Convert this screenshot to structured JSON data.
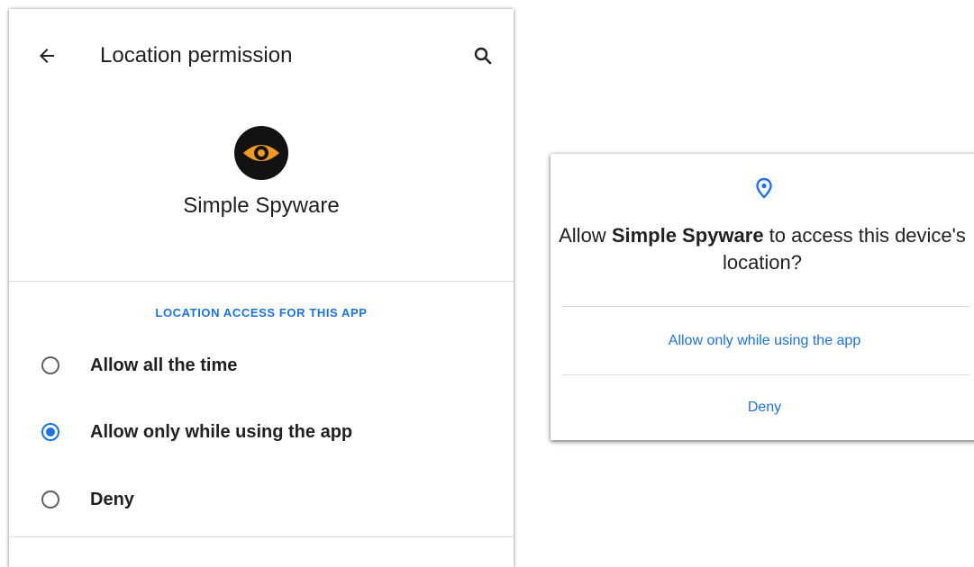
{
  "settings": {
    "title": "Location permission",
    "app_name": "Simple Spyware",
    "section_header": "LOCATION ACCESS FOR THIS APP",
    "options": [
      {
        "label": "Allow all the time",
        "checked": false
      },
      {
        "label": "Allow only while using the app",
        "checked": true
      },
      {
        "label": "Deny",
        "checked": false
      }
    ],
    "icons": {
      "back": "arrow-back-icon",
      "search": "search-icon",
      "app": "eye-icon"
    }
  },
  "dialog": {
    "icon": "location-pin-icon",
    "message_prefix": "Allow ",
    "message_app": "Simple Spyware",
    "message_suffix": " to access this device's location?",
    "allow_label": "Allow only while using the app",
    "deny_label": "Deny"
  },
  "colors": {
    "accent": "#1a73e8",
    "app_icon_bg": "#121212",
    "app_icon_eye": "#f29a1f",
    "text": "#202124"
  }
}
